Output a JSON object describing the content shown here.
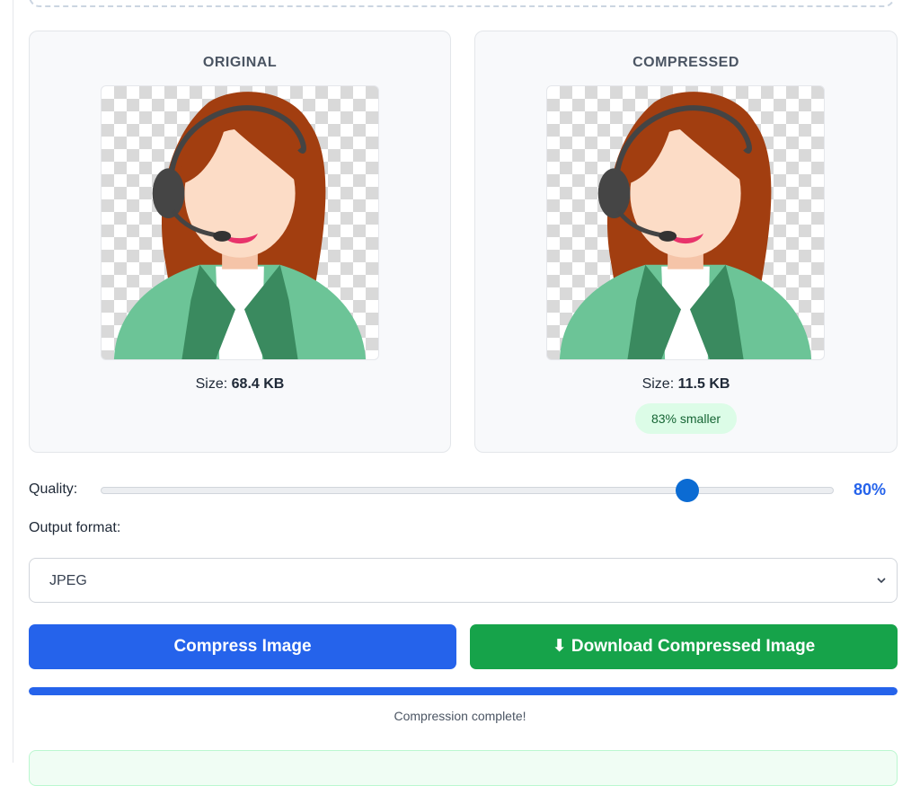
{
  "original": {
    "title": "ORIGINAL",
    "size_label": "Size:",
    "size_value": "68.4 KB",
    "image_alt": "operator-avatar-illustration"
  },
  "compressed": {
    "title": "COMPRESSED",
    "size_label": "Size:",
    "size_value": "11.5 KB",
    "savings_badge": "83% smaller",
    "image_alt": "operator-avatar-illustration"
  },
  "controls": {
    "quality_label": "Quality:",
    "quality_percent": 80,
    "quality_display": "80%",
    "slider_fill_fraction": 0.8,
    "format_label": "Output format:",
    "format_selected": "JPEG"
  },
  "actions": {
    "compress_label": "Compress Image",
    "download_label": "⬇ Download Compressed Image"
  },
  "progress": {
    "fraction": 1.0,
    "status": "Compression complete!"
  },
  "colors": {
    "primary": "#2563eb",
    "success": "#16a34a",
    "badge_bg": "#dcfce7",
    "badge_text": "#166534",
    "slider_thumb": "#0b6bd3"
  },
  "icons": {
    "select_chevron": "chevron-down-icon",
    "download": "download-arrow-icon"
  }
}
